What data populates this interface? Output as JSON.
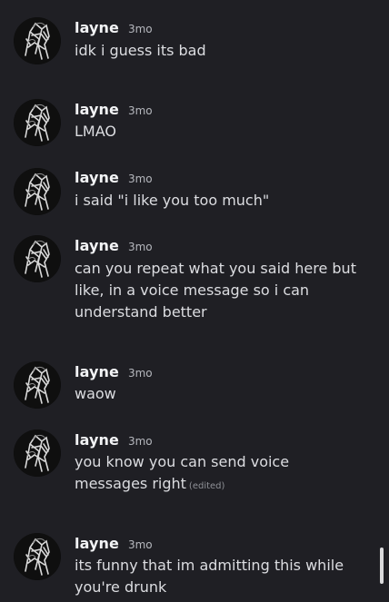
{
  "messages": [
    {
      "username": "layne",
      "timestamp": "3mo",
      "text": "idk i guess its bad",
      "edited": ""
    },
    {
      "username": "layne",
      "timestamp": "3mo",
      "text": "LMAO",
      "edited": ""
    },
    {
      "username": "layne",
      "timestamp": "3mo",
      "text": "i said \"i like you too much\"",
      "edited": ""
    },
    {
      "username": "layne",
      "timestamp": "3mo",
      "text": "can you repeat what you said here but like, in a voice message so i can understand better",
      "edited": ""
    },
    {
      "username": "layne",
      "timestamp": "3mo",
      "text": "waow",
      "edited": ""
    },
    {
      "username": "layne",
      "timestamp": "3mo",
      "text": "you know you can send voice messages right",
      "edited": "(edited)"
    },
    {
      "username": "layne",
      "timestamp": "3mo",
      "text": "its funny that im admitting this while you're drunk",
      "edited": ""
    }
  ],
  "icons": {
    "avatar": "user-avatar-icon"
  },
  "colors": {
    "background": "#1f1f24",
    "username": "#f2f3f5",
    "message_text": "#dcdde1",
    "timestamp": "#b5b7bd",
    "edited": "#8f9197",
    "scrollbar": "#d9d9db"
  }
}
